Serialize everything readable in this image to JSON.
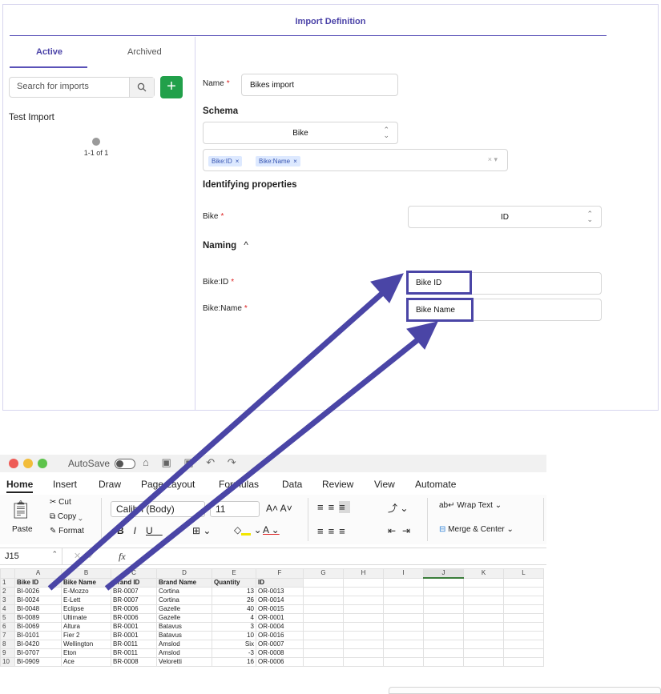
{
  "import_panel": {
    "header_title": "Import Definition",
    "tabs": [
      {
        "label": "Active"
      },
      {
        "label": "Archived"
      }
    ],
    "search": {
      "placeholder": "Search for imports"
    },
    "add_button_label": "+",
    "imports": [
      {
        "name": "Test Import"
      }
    ],
    "pagination": "1-1 of 1",
    "form": {
      "name_label": "Name",
      "name_value": "Bikes import",
      "required_mark": "*",
      "schema_title": "Schema",
      "schema_value": "Bike",
      "chips": [
        {
          "label": "Bike:ID"
        },
        {
          "label": "Bike:Name"
        }
      ],
      "chip_remove": "×",
      "chips_clear": "× ▾",
      "identifying_title": "Identifying properties",
      "identifying_label": "Bike",
      "identifying_value": "ID",
      "naming_title": "Naming",
      "naming_rows": [
        {
          "label": "Bike:ID",
          "value": "Bike ID"
        },
        {
          "label": "Bike:Name",
          "value": "Bike Name"
        }
      ]
    }
  },
  "excel": {
    "autosave_label": "AutoSave",
    "menu_tabs": [
      "Home",
      "Insert",
      "Draw",
      "Page Layout",
      "Formulas",
      "Data",
      "Review",
      "View",
      "Automate"
    ],
    "ribbon": {
      "paste": "Paste",
      "cut": "Cut",
      "copy": "Copy",
      "format": "Format",
      "font_name": "Calibri (Body)",
      "font_size": "11",
      "wrap_text": "Wrap Text",
      "merge_center": "Merge & Center"
    },
    "name_box": "J15",
    "fx_label": "fx",
    "columns": [
      "A",
      "B",
      "C",
      "D",
      "E",
      "F",
      "G",
      "H",
      "I",
      "J",
      "K",
      "L"
    ],
    "selected_column": "J",
    "headers": [
      "Bike ID",
      "Bike Name",
      "Brand ID",
      "Brand Name",
      "Quantity",
      "ID"
    ],
    "rows": [
      [
        "BI-0026",
        "E-Mozzo",
        "BR-0007",
        "Cortina",
        "13",
        "OR-0013"
      ],
      [
        "BI-0024",
        "E-Lett",
        "BR-0007",
        "Cortina",
        "26",
        "OR-0014"
      ],
      [
        "BI-0048",
        "Eclipse",
        "BR-0006",
        "Gazelle",
        "40",
        "OR-0015"
      ],
      [
        "BI-0089",
        "Ultimate",
        "BR-0006",
        "Gazelle",
        "4",
        "OR-0001"
      ],
      [
        "BI-0069",
        "Altura",
        "BR-0001",
        "Batavus",
        "3",
        "OR-0004"
      ],
      [
        "BI-0101",
        "Fier 2",
        "BR-0001",
        "Batavus",
        "10",
        "OR-0016"
      ],
      [
        "BI-0420",
        "Wellington",
        "BR-0011",
        "Amslod",
        "Six",
        "OR-0007"
      ],
      [
        "BI-0707",
        "Eton",
        "BR-0011",
        "Amslod",
        "-3",
        "OR-0008"
      ],
      [
        "BI-0909",
        "Ace",
        "BR-0008",
        "Veloretti",
        "16",
        "OR-0006"
      ]
    ]
  },
  "colors": {
    "accent": "#4a45a6",
    "add_button": "#21a04a",
    "required": "#dd2222"
  }
}
